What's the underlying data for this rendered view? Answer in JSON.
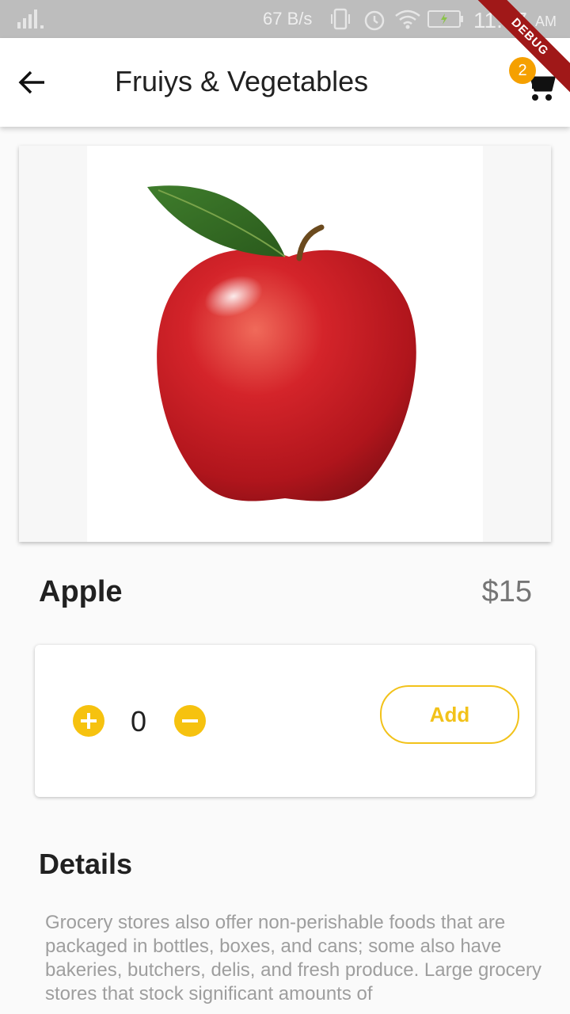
{
  "status_bar": {
    "speed": "67 B/s",
    "time": "11:57",
    "ampm": "AM",
    "debug_label": "DEBUG"
  },
  "app_bar": {
    "title": "Fruiys & Vegetables",
    "cart_count": "2"
  },
  "product": {
    "name": "Apple",
    "price": "$15",
    "quantity": "0",
    "add_label": "Add"
  },
  "details": {
    "title": "Details",
    "body": "Grocery stores also offer non-perishable foods that are packaged in bottles, boxes, and cans; some also have bakeries, butchers, delis, and fresh produce. Large grocery stores that stock significant amounts of"
  },
  "icons": {
    "back": "arrow-back-icon",
    "cart": "shopping-cart-icon",
    "plus": "plus-circle-icon",
    "minus": "minus-circle-icon"
  },
  "colors": {
    "accent": "#f6c20f",
    "badge": "#f5a000",
    "ribbon": "#a01818"
  }
}
